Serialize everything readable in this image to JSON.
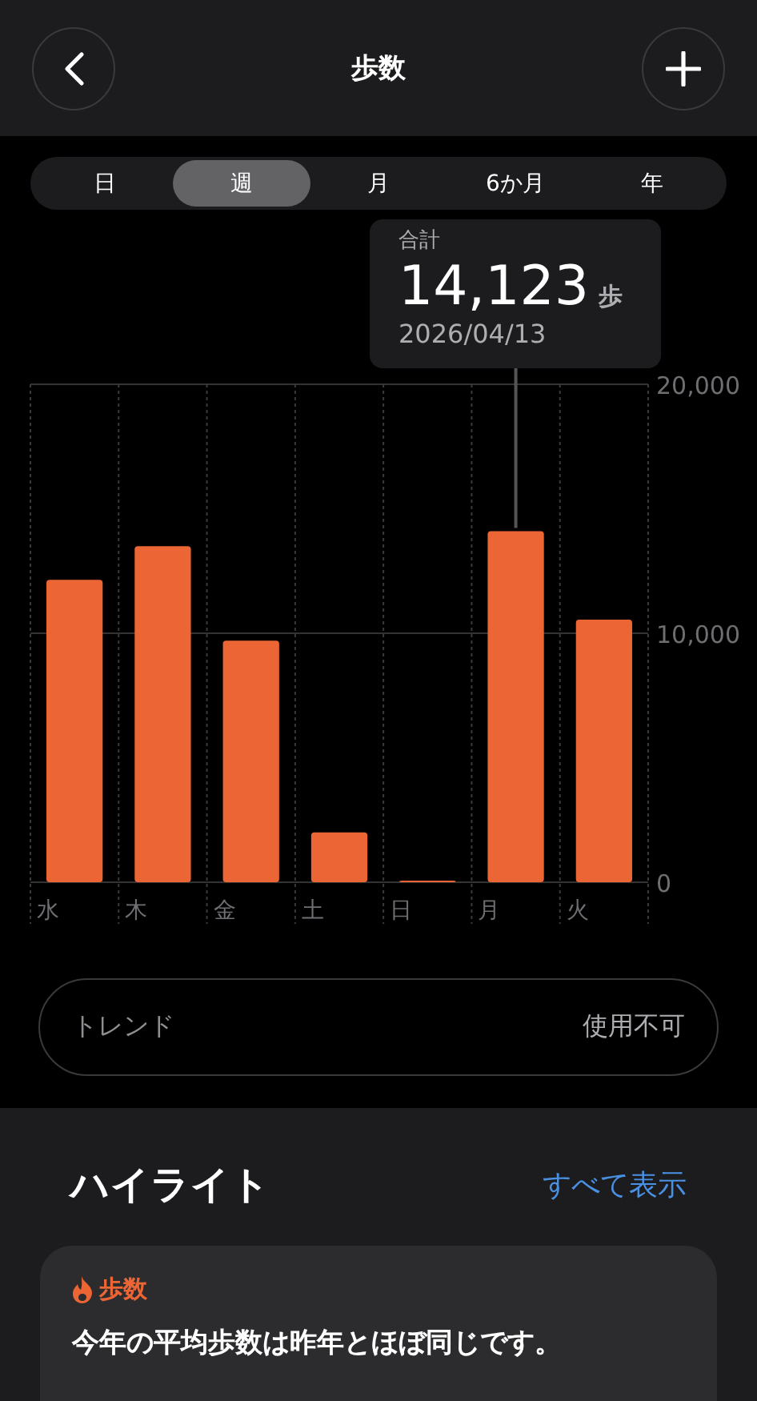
{
  "header": {
    "title": "歩数"
  },
  "tabs": [
    {
      "label": "日",
      "selected": false
    },
    {
      "label": "週",
      "selected": true
    },
    {
      "label": "月",
      "selected": false
    },
    {
      "label": "6か月",
      "selected": false
    },
    {
      "label": "年",
      "selected": false
    }
  ],
  "tooltip": {
    "label": "合計",
    "value": "14,123",
    "unit": "歩",
    "date": "2026/04/13"
  },
  "chart_data": {
    "type": "bar",
    "categories": [
      "水",
      "木",
      "金",
      "土",
      "日",
      "月",
      "火"
    ],
    "series": [
      {
        "color": "#ec6534",
        "values": [
          12150,
          13500,
          9700,
          2000,
          60,
          14100,
          10550
        ]
      }
    ],
    "ylim": [
      0,
      20000
    ],
    "yticks": [
      {
        "value": 0,
        "label": "0"
      },
      {
        "value": 10000,
        "label": "10,000"
      },
      {
        "value": 20000,
        "label": "20,000"
      }
    ]
  },
  "trend": {
    "label": "トレンド",
    "value": "使用不可"
  },
  "highlights": {
    "title": "ハイライト",
    "link": "すべて表示",
    "card": {
      "category": "歩数",
      "text": "今年の平均歩数は昨年とほぼ同じです。"
    }
  }
}
